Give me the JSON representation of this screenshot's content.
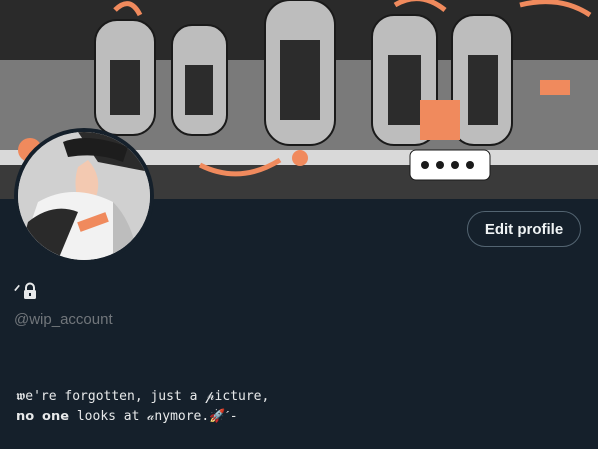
{
  "profile": {
    "display_name": "ᐟ",
    "handle": "@wip_account",
    "edit_button_label": "Edit profile",
    "bio_line_1": "𝖜e're forgotten, just a 𝓅icture,",
    "bio_line_2": "𝗻𝗼 𝗼𝗻𝗲 looks at 𝒶nymore.🚀ˊ-"
  },
  "icons": {
    "lock": "lock-icon"
  },
  "colors": {
    "background": "#15202b",
    "text_primary": "#e7e9ea",
    "text_secondary": "#71767b",
    "button_border": "#536471",
    "banner_accent": "#f08a5d"
  }
}
